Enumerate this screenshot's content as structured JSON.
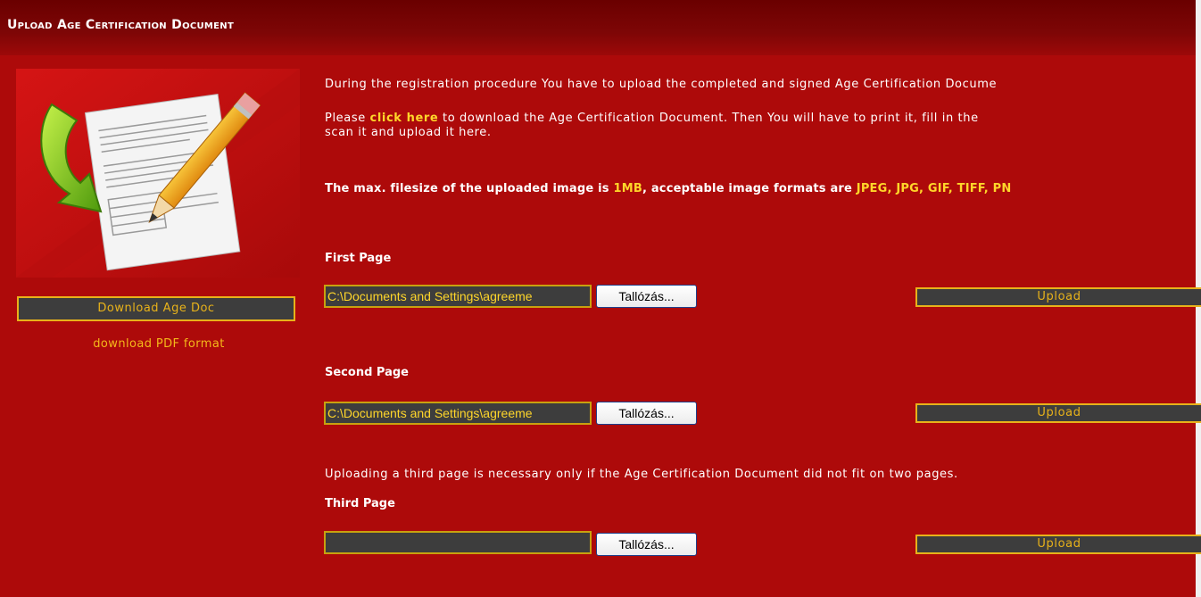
{
  "header": {
    "title": "Upload Age Certification Document"
  },
  "left": {
    "image_icon": "document-pencil-arrow-icon",
    "download_button": "Download Age Doc",
    "pdf_link": "download PDF format"
  },
  "content": {
    "intro_line1": "During the registration procedure You have to upload the completed and signed Age Certification Docume",
    "intro_line2_prefix": "Please ",
    "intro_line2_link": "click here",
    "intro_line2_suffix": " to download the Age Certification Document. Then You will have to print it, fill in the",
    "intro_line3": "scan it and upload it here.",
    "limits_prefix": "The max. filesize of the uploaded image is ",
    "limits_size": "1MB",
    "limits_mid": ", acceptable image formats are ",
    "limits_formats": "JPEG, JPG, GIF, TIFF, PN",
    "third_note": "Uploading a third page is necessary only if the Age Certification Document did not fit on two pages."
  },
  "pages": [
    {
      "label": "First Page",
      "value": "C:\\Documents and Settings\\agreeme",
      "browse": "Tallózás...",
      "upload": "Upload"
    },
    {
      "label": "Second Page",
      "value": "C:\\Documents and Settings\\agreeme",
      "browse": "Tallózás...",
      "upload": "Upload"
    },
    {
      "label": "Third Page",
      "value": "",
      "browse": "Tallózás...",
      "upload": "Upload"
    }
  ],
  "colors": {
    "background": "#ad0a0a",
    "header": "#6a0000",
    "accent": "#e8b21a",
    "highlight": "#ffd62a",
    "button": "#3d3d3d"
  }
}
